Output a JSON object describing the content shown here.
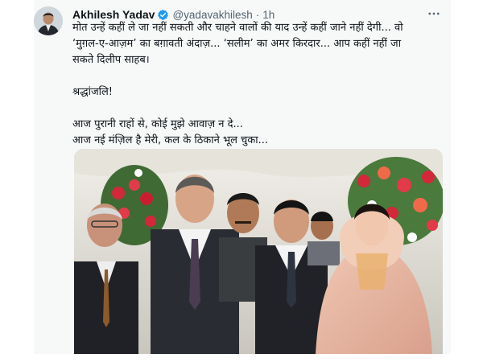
{
  "tweet": {
    "author_name": "Akhilesh Yadav",
    "handle": "@yadavakhilesh",
    "separator": "·",
    "time": "1h",
    "text_lines": [
      "मोत उन्हें कहीं ले जा नहीं सकती और चाहने वालों की याद उन्हें कहीं जाने नहीं देगी... वो",
      "‘मुग़ल-ए-आज़म’ का बग़ावती अंदाज़... ‘सलीम’ का अमर किरदार... आप कहीं नहीं जा",
      "सकते दिलीप साहब।",
      "श्रद्धांजलि!",
      "आज पुरानी राहों से, कोई मुझे आवाज़ न दे...",
      "आज नई मंज़िल है मेरी, कल के ठिकाने भूल चुका..."
    ],
    "icons": {
      "verified": "verified-badge-icon",
      "more": "more-options-icon"
    },
    "colors": {
      "verified": "#1d9bf0",
      "text": "#0f1419",
      "secondary_text": "#536471"
    }
  }
}
